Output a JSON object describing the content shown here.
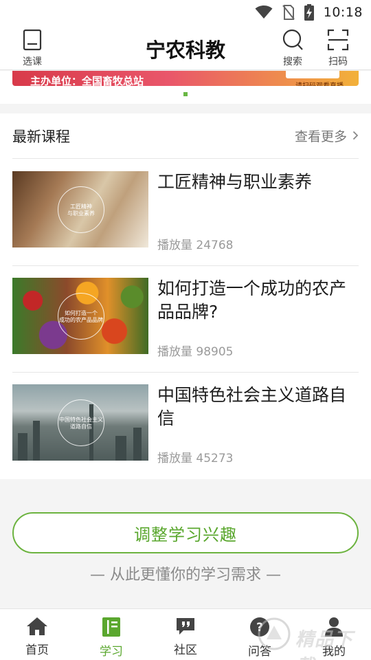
{
  "status_bar": {
    "time": "10:18"
  },
  "header": {
    "title": "宁农科教",
    "left_label": "选课",
    "search_label": "搜索",
    "scan_label": "扫码"
  },
  "banner": {
    "org_text": "主办单位：全国畜牧总站",
    "tag_text": "请扫码观看直播"
  },
  "courses_section": {
    "title": "最新课程",
    "more_label": "查看更多",
    "items": [
      {
        "title": "工匠精神与职业素养",
        "plays": "播放量 24768",
        "thumb_caption": "工匠精神\n与职业素养"
      },
      {
        "title": "如何打造一个成功的农产品品牌?",
        "plays": "播放量 98905",
        "thumb_caption": "如何打造一个\n成功的农产品品牌"
      },
      {
        "title": "中国特色社会主义道路自信",
        "plays": "播放量 45273",
        "thumb_caption": "中国特色社会主义\n道路自信"
      }
    ]
  },
  "adjust": {
    "button_label": "调整学习兴趣",
    "hint": "— 从此更懂你的学习需求 —"
  },
  "bottom_nav": {
    "items": [
      {
        "label": "首页",
        "icon": "home-icon"
      },
      {
        "label": "学习",
        "icon": "book-icon"
      },
      {
        "label": "社区",
        "icon": "quote-icon"
      },
      {
        "label": "问答",
        "icon": "question-icon"
      },
      {
        "label": "我的",
        "icon": "person-icon"
      }
    ],
    "active_index": 1
  },
  "watermark": {
    "text": "精品下载"
  },
  "colors": {
    "accent": "#5aa72e",
    "accent_border": "#6cb33f",
    "banner_red": "#d83a4a"
  }
}
